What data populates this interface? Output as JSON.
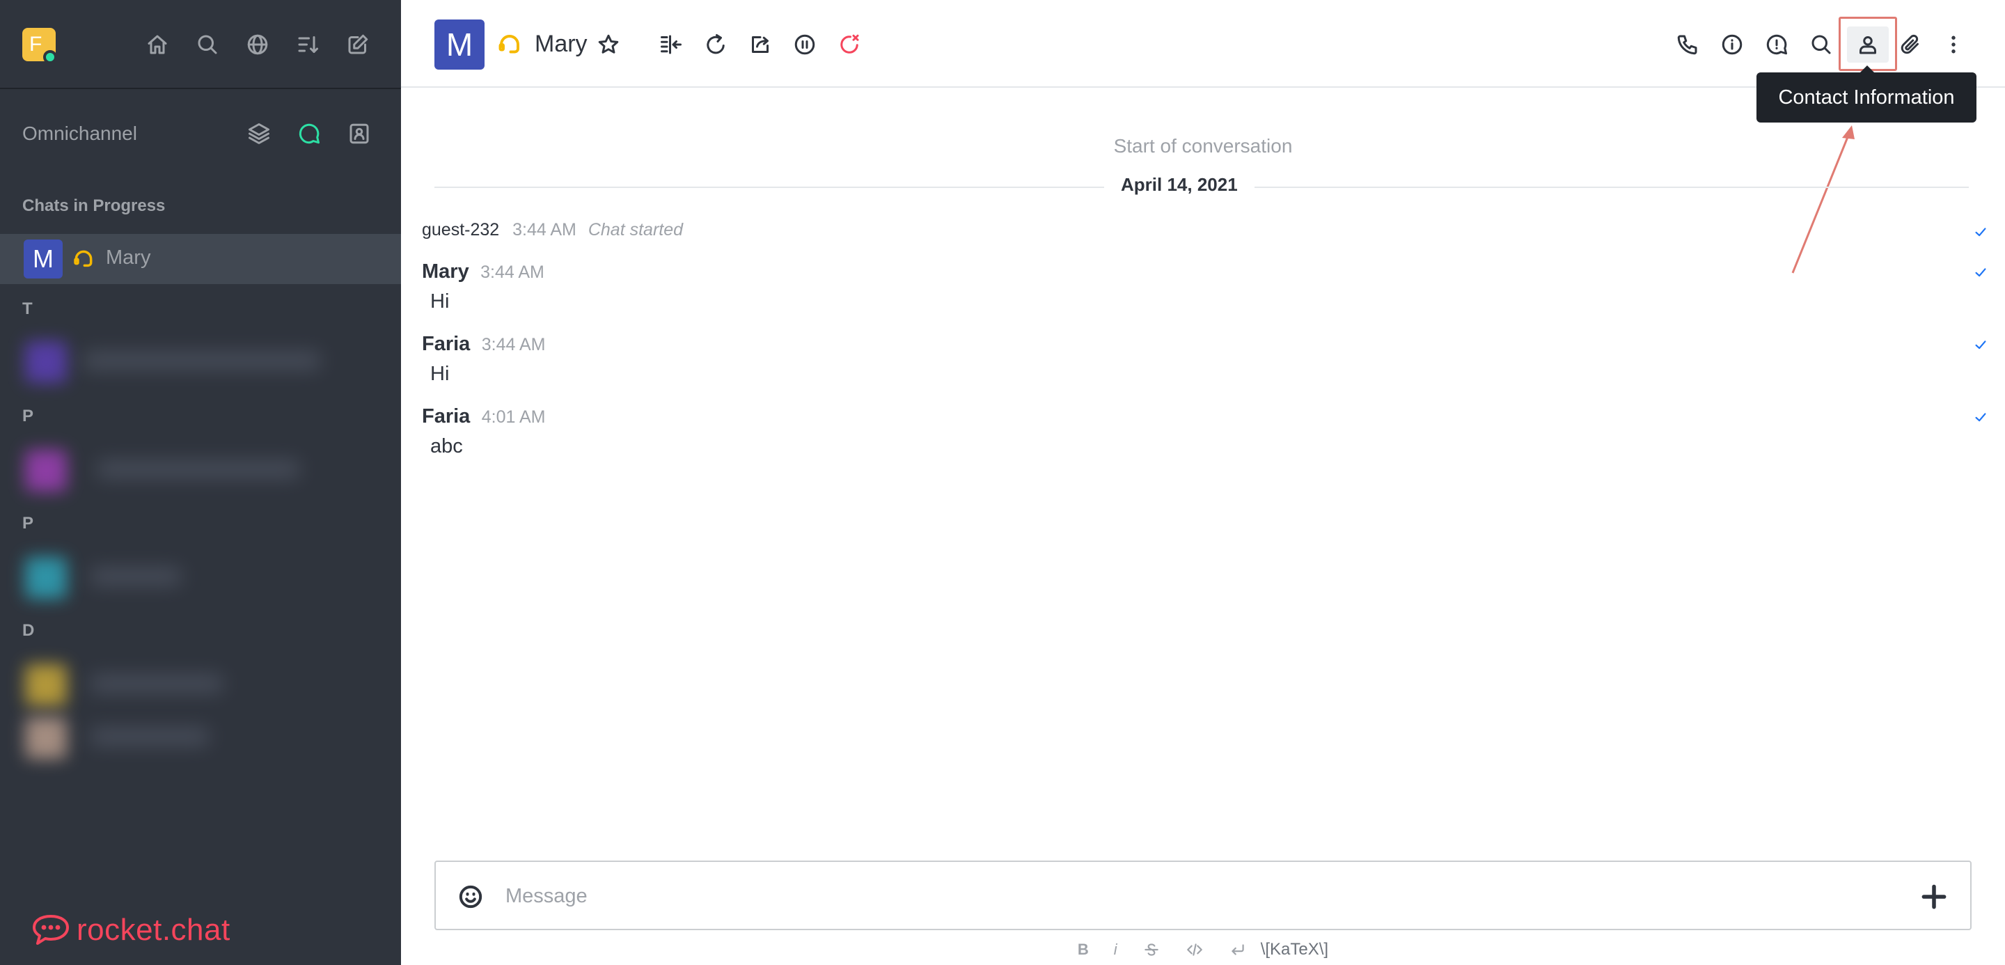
{
  "sidebar": {
    "user_avatar_letter": "F",
    "omnichannel_label": "Omnichannel",
    "section_heading": "Chats in Progress",
    "active_room": {
      "avatar_letter": "M",
      "name": "Mary"
    },
    "brand": "rocket.chat"
  },
  "header": {
    "avatar_letter": "M",
    "title": "Mary",
    "tooltip": "Contact Information"
  },
  "conversation": {
    "start_text": "Start of conversation",
    "date": "April 14, 2021",
    "system_message": {
      "user": "guest-232",
      "time": "3:44 AM",
      "text": "Chat started"
    },
    "messages": [
      {
        "user": "Mary",
        "time": "3:44 AM",
        "text": "Hi"
      },
      {
        "user": "Faria",
        "time": "3:44 AM",
        "text": "Hi"
      },
      {
        "user": "Faria",
        "time": "4:01 AM",
        "text": "abc"
      }
    ]
  },
  "composer": {
    "placeholder": "Message",
    "format": {
      "bold": "B",
      "italic": "i",
      "katex": "\\[KaTeX\\]"
    }
  },
  "colors": {
    "sidebar_bg": "#2f343d",
    "accent_red": "#f5455c",
    "avatar_blue": "#3f51b5",
    "agent_yellow": "#f5b800",
    "check_blue": "#1d74f5"
  }
}
